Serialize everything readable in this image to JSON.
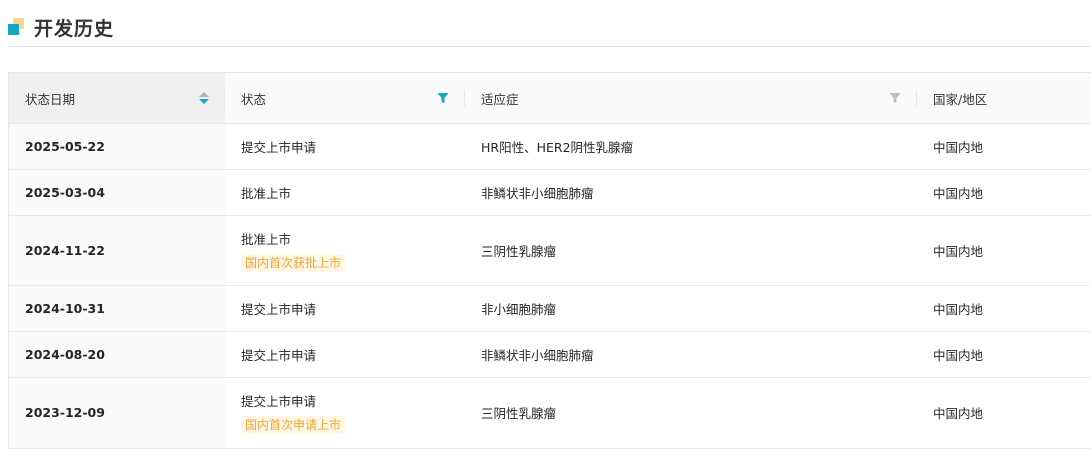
{
  "section": {
    "title": "开发历史"
  },
  "table": {
    "columns": {
      "date": "状态日期",
      "status": "状态",
      "indication": "适应症",
      "region": "国家/地区"
    },
    "rows": [
      {
        "date": "2025-05-22",
        "status": "提交上市申请",
        "tag": "",
        "indication": "HR阳性、HER2阴性乳腺瘤",
        "region": "中国内地"
      },
      {
        "date": "2025-03-04",
        "status": "批准上市",
        "tag": "",
        "indication": "非鳞状非小细胞肺瘤",
        "region": "中国内地"
      },
      {
        "date": "2024-11-22",
        "status": "批准上市",
        "tag": "国内首次获批上市",
        "indication": "三阴性乳腺瘤",
        "region": "中国内地"
      },
      {
        "date": "2024-10-31",
        "status": "提交上市申请",
        "tag": "",
        "indication": "非小细胞肺瘤",
        "region": "中国内地"
      },
      {
        "date": "2024-08-20",
        "status": "提交上市申请",
        "tag": "",
        "indication": "非鳞状非小细胞肺瘤",
        "region": "中国内地"
      },
      {
        "date": "2023-12-09",
        "status": "提交上市申请",
        "tag": "国内首次申请上市",
        "indication": "三阴性乳腺瘤",
        "region": "中国内地"
      }
    ]
  },
  "icons": {
    "section_mark": "section-marker-icon",
    "sort": "sort-icon",
    "status_filter": "filter-icon",
    "indication_filter": "filter-icon"
  },
  "colors": {
    "accent": "#13a8c2",
    "tag_text": "#f0a63a",
    "tag_bg": "#fff7e6",
    "filter_inactive": "#bfbfbf"
  }
}
